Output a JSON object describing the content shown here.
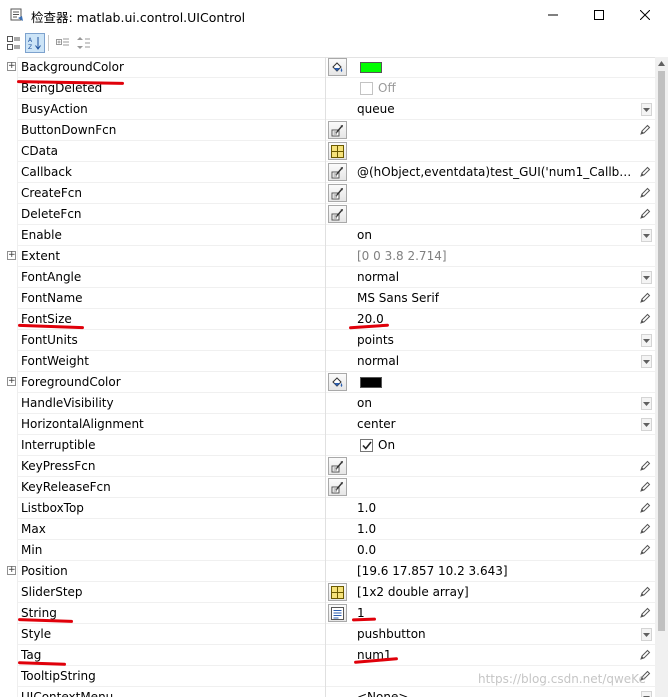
{
  "window": {
    "title": "检查器:  matlab.ui.control.UIControl"
  },
  "toolbar": {
    "icons": [
      "categorized-view-icon",
      "sort-alphabetical-icon",
      "expand-all-icon",
      "collapse-all-icon"
    ]
  },
  "properties": [
    {
      "name": "BackgroundColor",
      "kind": "color",
      "color": "#00ff00",
      "expandable": true,
      "button": "paint-bucket-icon"
    },
    {
      "name": "BeingDeleted",
      "kind": "checkbox",
      "checked": false,
      "value": "Off",
      "disabled": true
    },
    {
      "name": "BusyAction",
      "kind": "text",
      "value": "queue",
      "control": "dropdown"
    },
    {
      "name": "ButtonDownFcn",
      "kind": "text",
      "value": "",
      "button": "function-handle-icon",
      "control": "edit"
    },
    {
      "name": "CData",
      "kind": "text",
      "value": "",
      "button": "matrix-grid-icon"
    },
    {
      "name": "Callback",
      "kind": "text",
      "value": "@(hObject,eventdata)test_GUI('num1_Callback...",
      "button": "function-handle-icon",
      "control": "edit"
    },
    {
      "name": "CreateFcn",
      "kind": "text",
      "value": "",
      "button": "function-handle-icon",
      "control": "edit"
    },
    {
      "name": "DeleteFcn",
      "kind": "text",
      "value": "",
      "button": "function-handle-icon",
      "control": "edit"
    },
    {
      "name": "Enable",
      "kind": "text",
      "value": "on",
      "control": "dropdown"
    },
    {
      "name": "Extent",
      "kind": "text",
      "value": "[0 0 3.8 2.714]",
      "dim": true,
      "expandable": true
    },
    {
      "name": "FontAngle",
      "kind": "text",
      "value": "normal",
      "control": "dropdown"
    },
    {
      "name": "FontName",
      "kind": "text",
      "value": "MS Sans Serif",
      "control": "edit"
    },
    {
      "name": "FontSize",
      "kind": "text",
      "value": "20.0",
      "control": "edit"
    },
    {
      "name": "FontUnits",
      "kind": "text",
      "value": "points",
      "control": "dropdown"
    },
    {
      "name": "FontWeight",
      "kind": "text",
      "value": "normal",
      "control": "dropdown"
    },
    {
      "name": "ForegroundColor",
      "kind": "color",
      "color": "#000000",
      "expandable": true,
      "button": "paint-bucket-icon"
    },
    {
      "name": "HandleVisibility",
      "kind": "text",
      "value": "on",
      "control": "dropdown"
    },
    {
      "name": "HorizontalAlignment",
      "kind": "text",
      "value": "center",
      "control": "dropdown"
    },
    {
      "name": "Interruptible",
      "kind": "checkbox",
      "checked": true,
      "value": "On"
    },
    {
      "name": "KeyPressFcn",
      "kind": "text",
      "value": "",
      "button": "function-handle-icon",
      "control": "edit"
    },
    {
      "name": "KeyReleaseFcn",
      "kind": "text",
      "value": "",
      "button": "function-handle-icon",
      "control": "edit"
    },
    {
      "name": "ListboxTop",
      "kind": "text",
      "value": "1.0",
      "control": "edit"
    },
    {
      "name": "Max",
      "kind": "text",
      "value": "1.0",
      "control": "edit"
    },
    {
      "name": "Min",
      "kind": "text",
      "value": "0.0",
      "control": "edit"
    },
    {
      "name": "Position",
      "kind": "text",
      "value": "[19.6 17.857 10.2 3.643]",
      "expandable": true
    },
    {
      "name": "SliderStep",
      "kind": "text",
      "value": "[1x2  double array]",
      "button": "matrix-grid-icon",
      "control": "edit"
    },
    {
      "name": "String",
      "kind": "text",
      "value": "1",
      "button": "text-lines-icon",
      "control": "edit"
    },
    {
      "name": "Style",
      "kind": "text",
      "value": "pushbutton",
      "control": "dropdown"
    },
    {
      "name": "Tag",
      "kind": "text",
      "value": "num1",
      "control": "edit"
    },
    {
      "name": "TooltipString",
      "kind": "text",
      "value": "",
      "control": "edit"
    },
    {
      "name": "UIContextMenu",
      "kind": "text",
      "value": "<None>",
      "control": "dropdown"
    }
  ],
  "watermark": "https://blog.csdn.net/qweKe",
  "annotation_color": "#e0000a"
}
